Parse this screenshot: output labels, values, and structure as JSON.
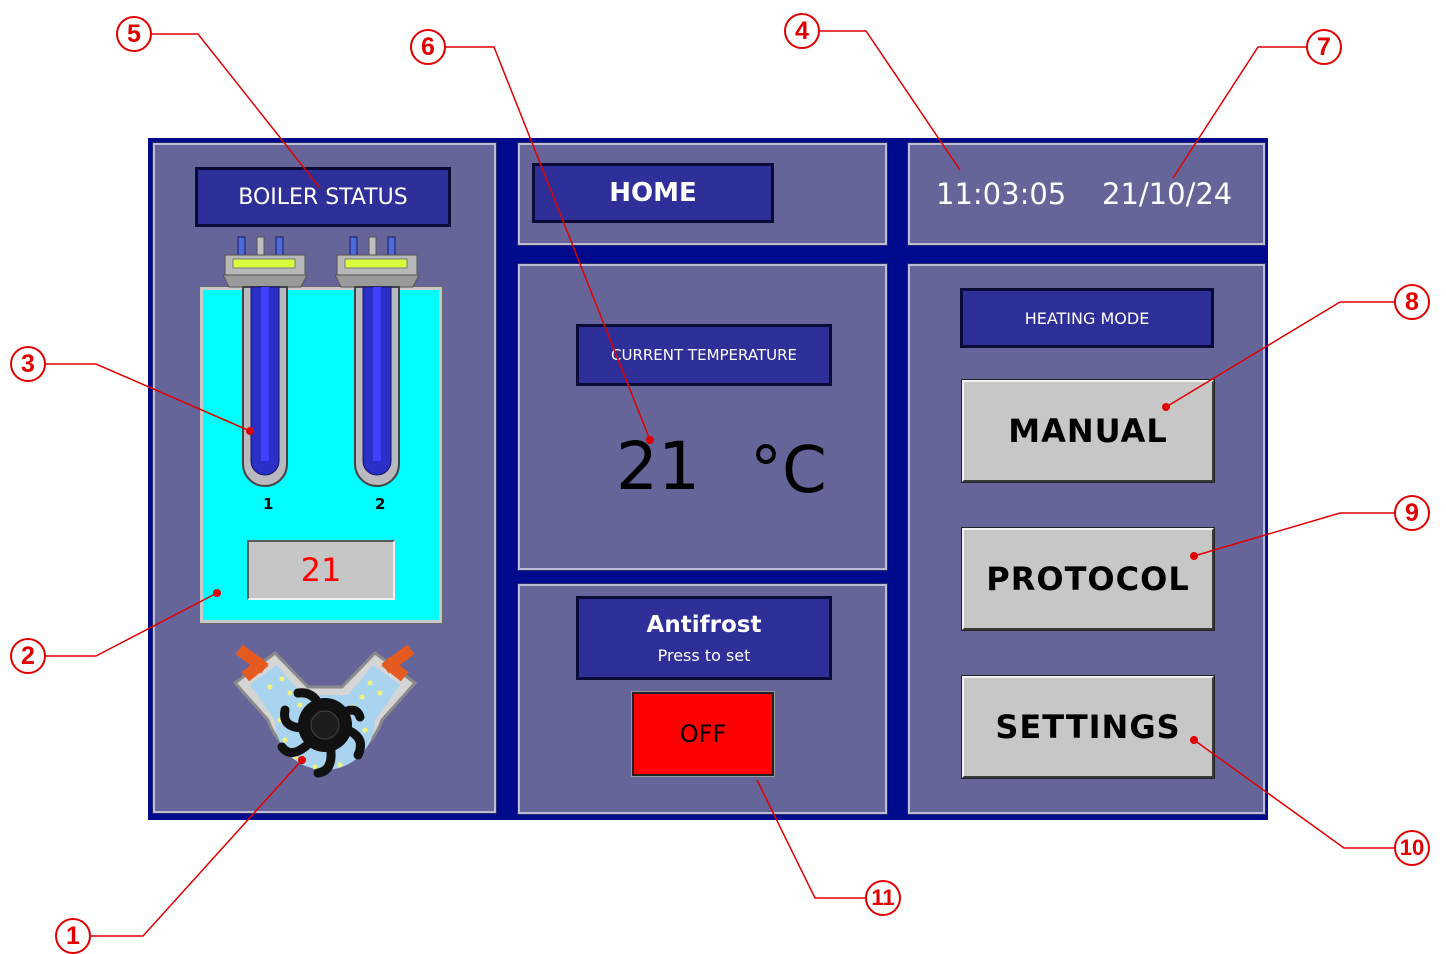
{
  "boiler": {
    "title": "BOILER STATUS",
    "heater_labels": [
      "1",
      "2"
    ],
    "water_temp": "21"
  },
  "home": {
    "title": "HOME"
  },
  "clock": {
    "time": "11:03:05",
    "date": "21/10/24"
  },
  "temperature": {
    "title": "CURRENT TEMPERATURE",
    "value": "21",
    "unit": "°C"
  },
  "heating_mode": {
    "title": "HEATING MODE",
    "manual_label": "MANUAL",
    "protocol_label": "PROTOCOL",
    "settings_label": "SETTINGS"
  },
  "antifrost": {
    "title": "Antifrost",
    "subtitle": "Press to set",
    "state": "OFF",
    "state_color": "#ff0000"
  },
  "callouts": [
    "1",
    "2",
    "3",
    "4",
    "5",
    "6",
    "7",
    "8",
    "9",
    "10",
    "11"
  ],
  "colors": {
    "screen_bg": "#000a8c",
    "panel": "#65659a",
    "label_bg": "#2f2f99",
    "water": "#00ffff",
    "callout": "#e00000",
    "button": "#c7c7c7"
  }
}
